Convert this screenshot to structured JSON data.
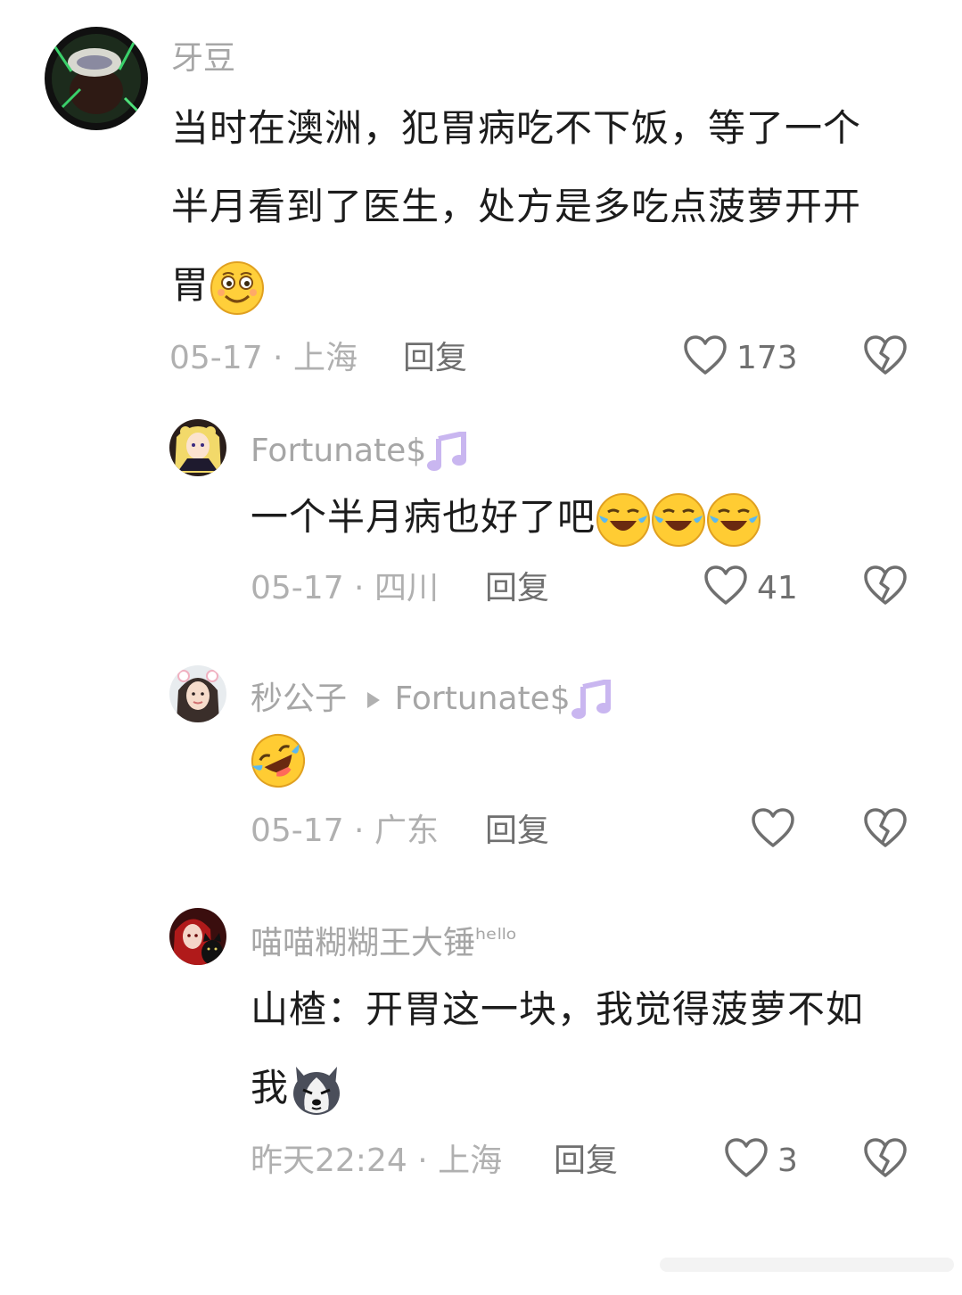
{
  "comments": [
    {
      "username": "牙豆",
      "lines": [
        "当时在澳洲，犯胃病吃不下饭，等了一个",
        "半月看到了医生，处方是多吃点菠萝开开",
        "胃"
      ],
      "emoji": "smile-emoji",
      "date_location": "05-17 · 上海",
      "reply_label": "回复",
      "like_count": "173"
    },
    {
      "username": "Fortunate$",
      "username_badge": "music-note-badge",
      "text": "一个半月病也好了吧",
      "emoji": "crying-laughing-emoji",
      "emoji_count": 3,
      "date_location": "05-17 · 四川",
      "reply_label": "回复",
      "like_count": "41"
    },
    {
      "username": "秒公子",
      "reply_to": "Fortunate$",
      "reply_to_badge": "music-note-badge",
      "emoji": "rofl-emoji",
      "date_location": "05-17 · 广东",
      "reply_label": "回复",
      "like_count": ""
    },
    {
      "username": "喵喵糊糊王大锤",
      "username_suffix": "ʰᵉˡˡᵒ",
      "lines": [
        "山楂：开胃这一块，我觉得菠萝不如",
        "我"
      ],
      "emoji": "husky-emoji",
      "date_location": "昨天22:24 · 上海",
      "reply_label": "回复",
      "like_count": "3"
    }
  ],
  "icons": {
    "like": "heart-outline-icon",
    "dislike": "broken-heart-icon"
  },
  "colors": {
    "text": "#1c1c1c",
    "muted": "#a6a6a6",
    "action": "#6f6f6f",
    "emoji_yellow": "#ffcc33",
    "badge_purple": "#c9b6f0"
  }
}
